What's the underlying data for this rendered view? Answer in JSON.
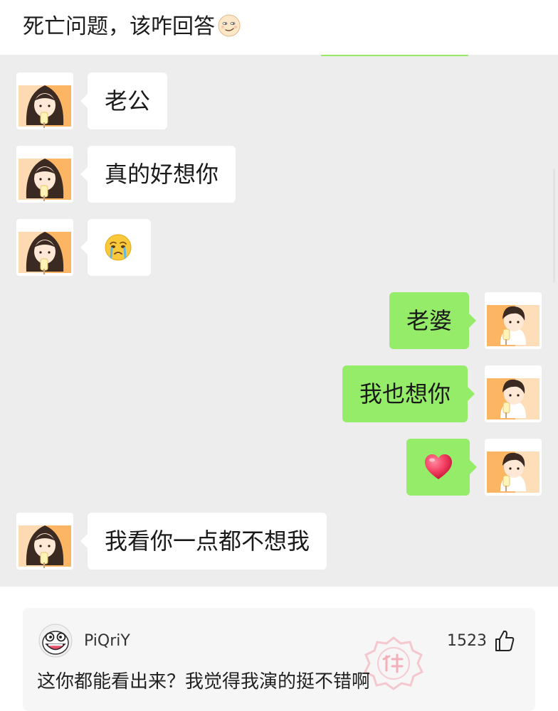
{
  "header": {
    "title": "死亡问题，该咋回答",
    "emoji_icon": "smirk-face-icon"
  },
  "chat": {
    "messages": [
      {
        "side": "left",
        "sender": "girl",
        "text": "老公"
      },
      {
        "side": "left",
        "sender": "girl",
        "text": "真的好想你"
      },
      {
        "side": "left",
        "sender": "girl",
        "text": "",
        "icon": "crying-face-icon"
      },
      {
        "side": "right",
        "sender": "boy",
        "text": "老婆"
      },
      {
        "side": "right",
        "sender": "boy",
        "text": "我也想你"
      },
      {
        "side": "right",
        "sender": "boy",
        "text": "",
        "icon": "red-heart-icon"
      },
      {
        "side": "left",
        "sender": "girl",
        "text": "我看你一点都不想我"
      }
    ],
    "colors": {
      "background": "#ededed",
      "left_bubble": "#ffffff",
      "right_bubble": "#95ec69"
    }
  },
  "comment": {
    "username": "PiQriY",
    "likes": "1523",
    "text": "这你都能看出来？我觉得我演的挺不错啊",
    "avatar_icon": "laughing-cartoon-avatar-icon",
    "like_icon": "thumbs-up-icon",
    "badge_icon": "god-comment-stamp-icon"
  }
}
